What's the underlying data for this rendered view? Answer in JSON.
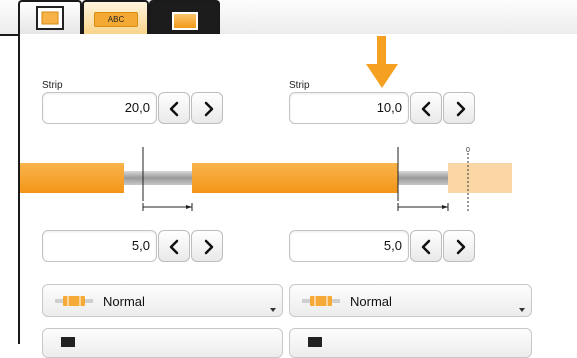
{
  "tabs": [
    {
      "name": "wire-settings-tab",
      "label": ""
    },
    {
      "name": "marking-tab",
      "label": "ABC"
    },
    {
      "name": "strip-tab",
      "label": ""
    }
  ],
  "strip_left": {
    "label": "Strip",
    "value": "20,0"
  },
  "strip_right": {
    "label": "Strip",
    "value": "10,0"
  },
  "diagram": {
    "zero_marker": "0",
    "colors": {
      "insulation": "#f5a02a",
      "conductor": "#a6a6a6",
      "arrow": "#f5a020"
    }
  },
  "lower_left": {
    "value": "5,0"
  },
  "lower_right": {
    "value": "5,0"
  },
  "mode_left": {
    "label": "Normal"
  },
  "mode_right": {
    "label": "Normal"
  }
}
